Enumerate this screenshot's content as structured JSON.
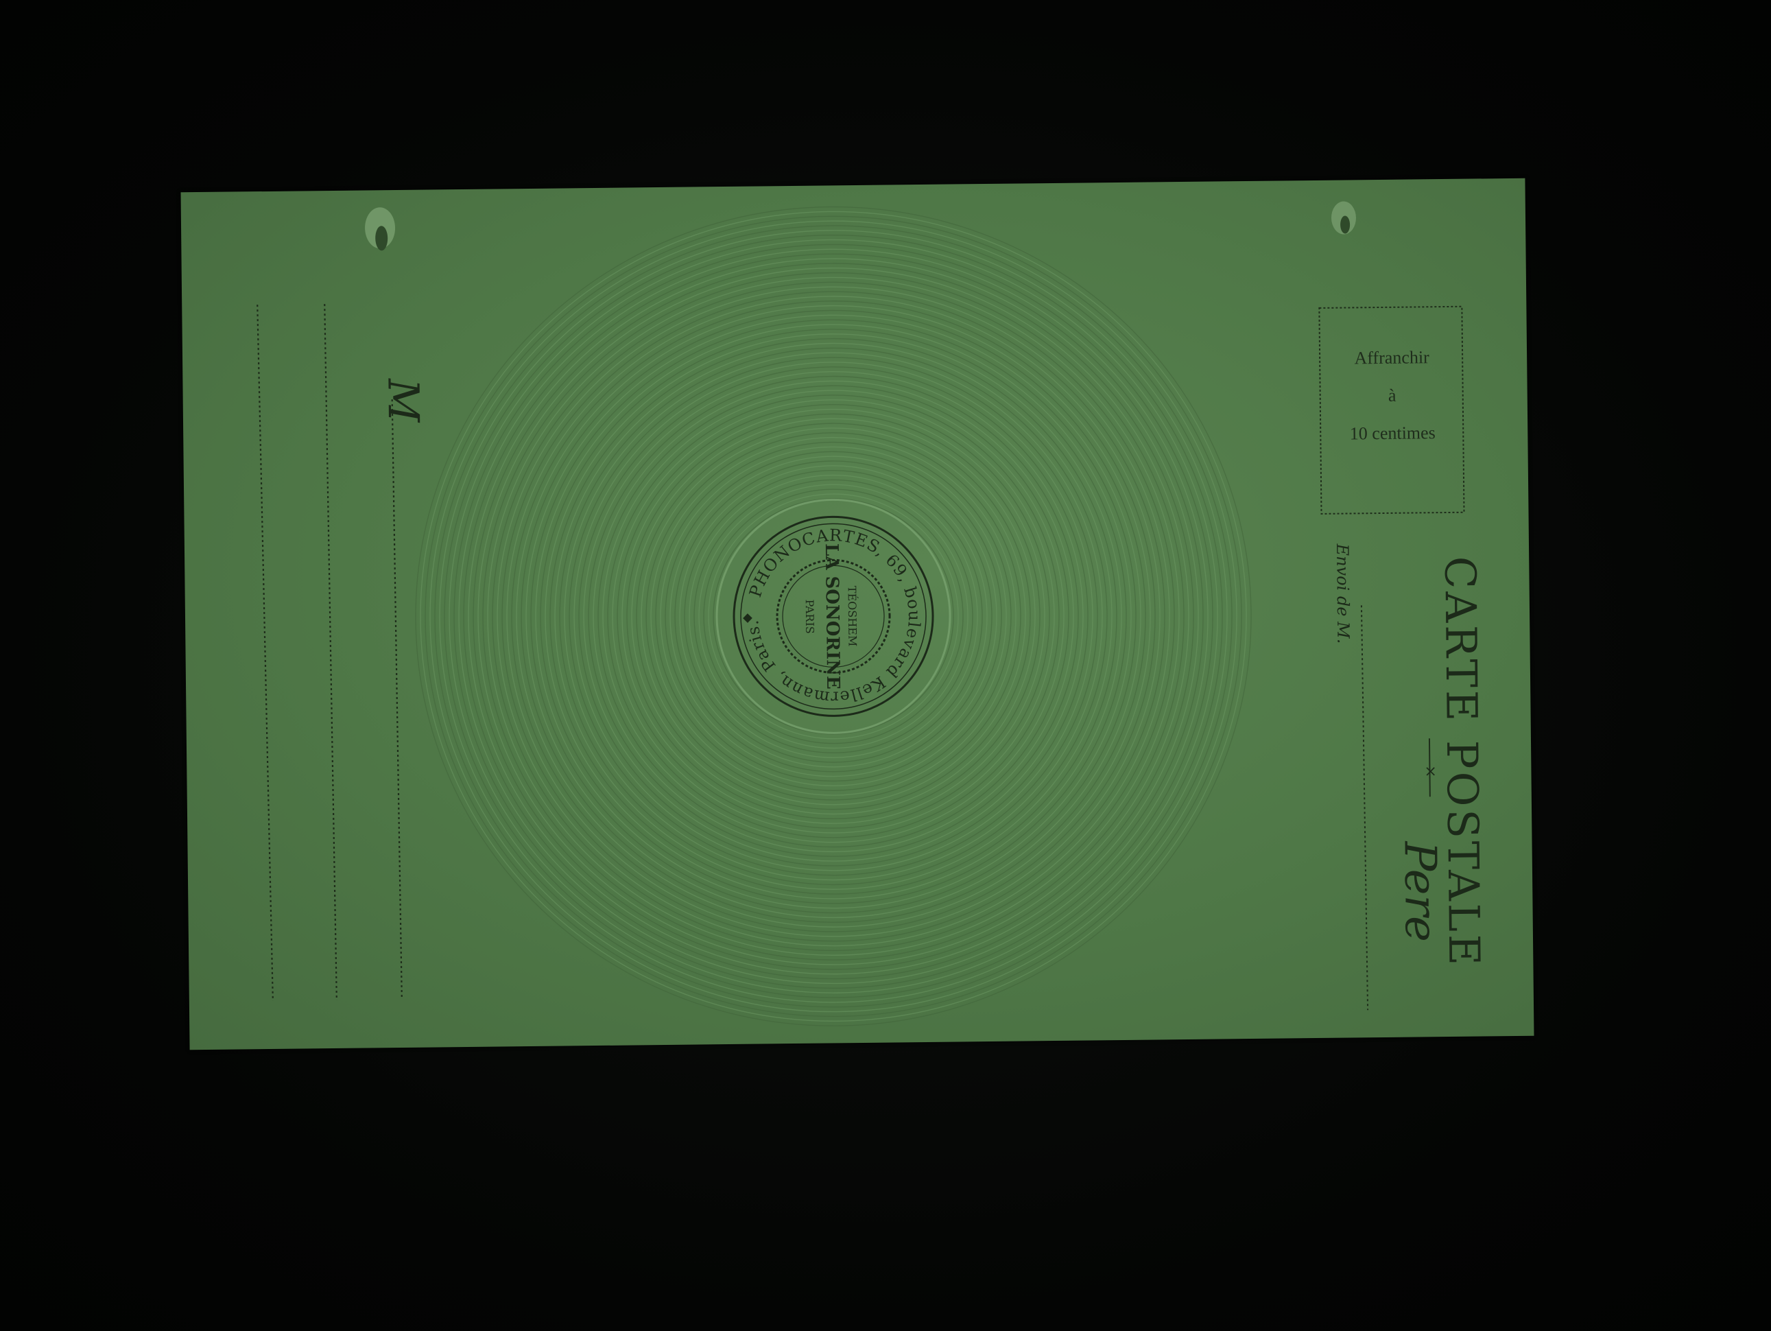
{
  "postcard": {
    "title": "CARTE POSTALE",
    "stamp_box": {
      "line1": "Affranchir",
      "line2": "à",
      "line3": "10 centimes"
    },
    "sender_prefix": "Envoi de M.",
    "sender_handwritten": "Pere",
    "recipient_prefix": "M",
    "seal": {
      "outer_ring": "PHONOCARTES, 69, boulevard Kellermann, Paris.",
      "brand": "LA SONORINE",
      "trademark": "TÉOSHEM",
      "city": "PARIS"
    }
  },
  "colors": {
    "background": "#050705",
    "card": "#4f7847",
    "ink": "#1c2a19"
  }
}
